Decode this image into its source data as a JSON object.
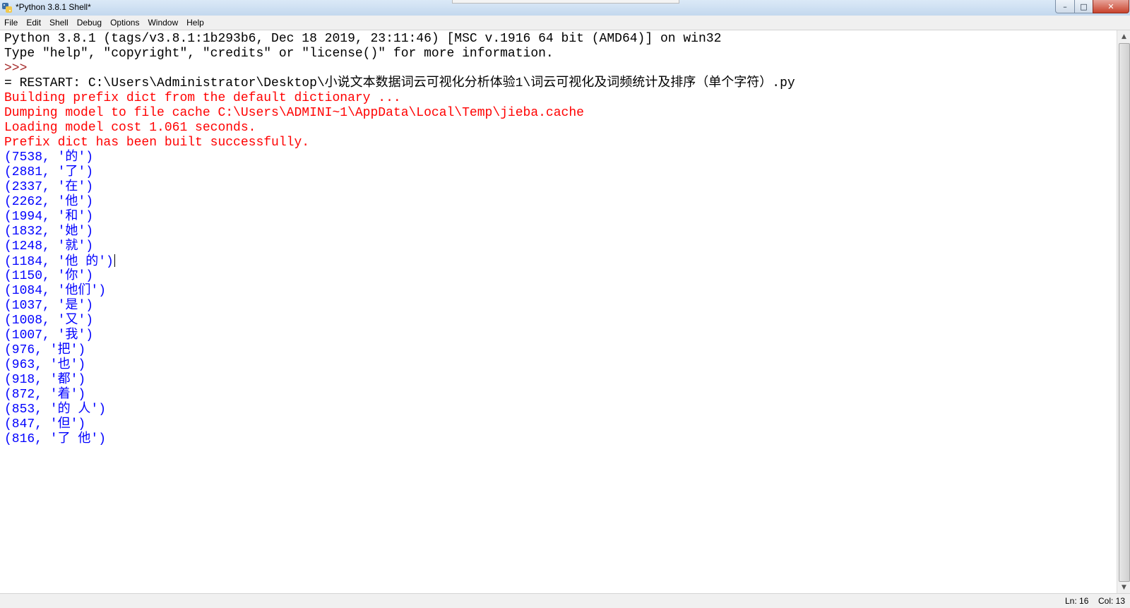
{
  "window": {
    "title": "*Python 3.8.1 Shell*",
    "minimize_glyph": "–",
    "maximize_glyph": "□",
    "close_glyph": "✕"
  },
  "menu": [
    "File",
    "Edit",
    "Shell",
    "Debug",
    "Options",
    "Window",
    "Help"
  ],
  "shell_lines": [
    {
      "text": "Python 3.8.1 (tags/v3.8.1:1b293b6, Dec 18 2019, 23:11:46) [MSC v.1916 64 bit (AMD64)] on win32",
      "kind": "normal"
    },
    {
      "text": "Type \"help\", \"copyright\", \"credits\" or \"license()\" for more information.",
      "kind": "normal"
    },
    {
      "text": ">>>",
      "kind": "prompt"
    },
    {
      "text": "= RESTART: C:\\Users\\Administrator\\Desktop\\小说文本数据词云可视化分析体验1\\词云可视化及词频统计及排序（单个字符）.py",
      "kind": "normal"
    },
    {
      "text": "Building prefix dict from the default dictionary ...",
      "kind": "error"
    },
    {
      "text": "Dumping model to file cache C:\\Users\\ADMINI~1\\AppData\\Local\\Temp\\jieba.cache",
      "kind": "error"
    },
    {
      "text": "Loading model cost 1.061 seconds.",
      "kind": "error"
    },
    {
      "text": "Prefix dict has been built successfully.",
      "kind": "error"
    },
    {
      "text": "(7538, '的')",
      "kind": "output"
    },
    {
      "text": "(2881, '了')",
      "kind": "output"
    },
    {
      "text": "(2337, '在')",
      "kind": "output"
    },
    {
      "text": "(2262, '他')",
      "kind": "output"
    },
    {
      "text": "(1994, '和')",
      "kind": "output"
    },
    {
      "text": "(1832, '她')",
      "kind": "output"
    },
    {
      "text": "(1248, '就')",
      "kind": "output"
    },
    {
      "text": "(1184, '他 的')",
      "kind": "output",
      "caret": true
    },
    {
      "text": "(1150, '你')",
      "kind": "output"
    },
    {
      "text": "(1084, '他们')",
      "kind": "output"
    },
    {
      "text": "(1037, '是')",
      "kind": "output"
    },
    {
      "text": "(1008, '又')",
      "kind": "output"
    },
    {
      "text": "(1007, '我')",
      "kind": "output"
    },
    {
      "text": "(976, '把')",
      "kind": "output"
    },
    {
      "text": "(963, '也')",
      "kind": "output"
    },
    {
      "text": "(918, '都')",
      "kind": "output"
    },
    {
      "text": "(872, '着')",
      "kind": "output"
    },
    {
      "text": "(853, '的 人')",
      "kind": "output"
    },
    {
      "text": "(847, '但')",
      "kind": "output"
    },
    {
      "text": "(816, '了 他')",
      "kind": "output"
    }
  ],
  "status": {
    "ln": "Ln: 16",
    "col": "Col: 13"
  },
  "colors": {
    "normal": "#000000",
    "prompt": "#a52a2a",
    "error": "#ff0000",
    "output": "#0000ff"
  }
}
